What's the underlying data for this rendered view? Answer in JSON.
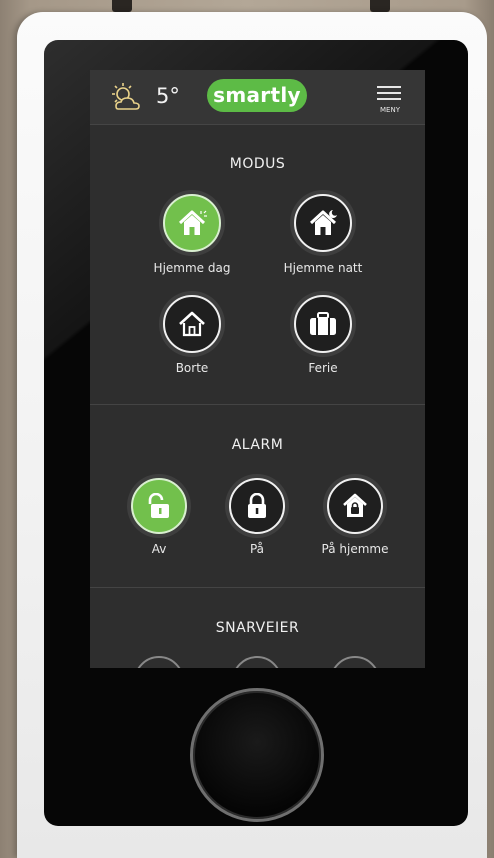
{
  "status_bar": {
    "weather_icon": "partly-cloudy-icon",
    "temperature": "5°",
    "logo_text": "smartly",
    "menu_label": "MENY"
  },
  "modus": {
    "title": "MODUS",
    "buttons": [
      {
        "label": "Hjemme dag",
        "icon": "home-sun-icon",
        "active": true
      },
      {
        "label": "Hjemme natt",
        "icon": "home-moon-icon",
        "active": false
      },
      {
        "label": "Borte",
        "icon": "home-outline-icon",
        "active": false
      },
      {
        "label": "Ferie",
        "icon": "suitcase-icon",
        "active": false
      }
    ]
  },
  "alarm": {
    "title": "ALARM",
    "buttons": [
      {
        "label": "Av",
        "icon": "unlocked-icon",
        "active": true
      },
      {
        "label": "På",
        "icon": "locked-icon",
        "active": false
      },
      {
        "label": "På hjemme",
        "icon": "home-lock-icon",
        "active": false
      }
    ]
  },
  "shortcuts": {
    "title": "SNARVEIER"
  },
  "colors": {
    "accent": "#72c04c",
    "screen_bg": "#2e2e2e",
    "text": "#f0f0f0"
  }
}
